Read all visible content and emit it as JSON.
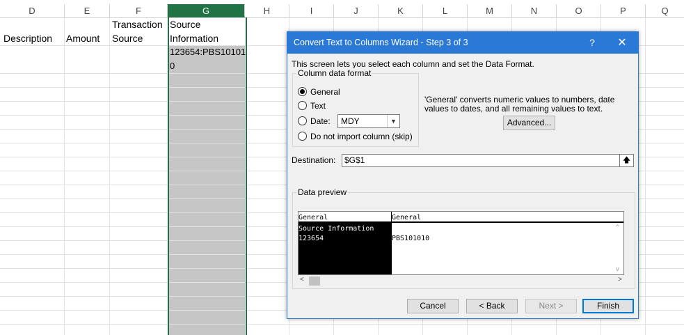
{
  "sheet": {
    "columns": [
      "D",
      "E",
      "F",
      "G",
      "H",
      "I",
      "J",
      "K",
      "L",
      "M",
      "N",
      "O",
      "P",
      "Q"
    ],
    "selected_column": "G",
    "header_row": {
      "d": "Description",
      "e": "Amount",
      "f_line1": "Transaction",
      "f_line2": "Source",
      "g_line1": "Source",
      "g_line2": "Information"
    },
    "g2_line1": "123654:PBS10101",
    "g2_line2": "0"
  },
  "dialog": {
    "title": "Convert Text to Columns Wizard - Step 3 of 3",
    "help_glyph": "?",
    "close_glyph": "✕",
    "intro": "This screen lets you select each column and set the Data Format.",
    "format_group_label": "Column data format",
    "options": {
      "general": "General",
      "text": "Text",
      "date": "Date:",
      "skip": "Do not import column (skip)"
    },
    "selected_option": "general",
    "date_format": "MDY",
    "general_note": "'General' converts numeric values to numbers, date values to dates, and all remaining values to text.",
    "advanced_label": "Advanced...",
    "destination_label": "Destination:",
    "destination_value": "$G$1",
    "preview_label": "Data preview",
    "preview": {
      "headers": [
        "General",
        "General"
      ],
      "col1": [
        "Source Information",
        "123654"
      ],
      "col2": [
        "",
        "PBS101010"
      ]
    },
    "buttons": {
      "cancel": "Cancel",
      "back": "< Back",
      "next": "Next >",
      "finish": "Finish"
    },
    "accent_color": "#2b79d6",
    "excel_green": "#217346"
  }
}
